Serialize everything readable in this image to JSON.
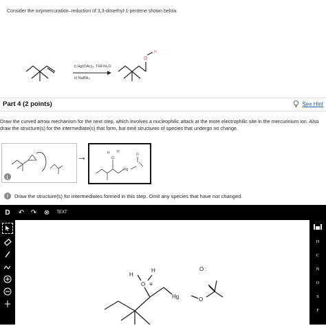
{
  "question": {
    "intro": "Consider the oxymercuration–reduction of 3,3-dimethyl-1-pentene shown below.",
    "reagent_step1": "i) Hg(OAc)₂, THF/H₂O",
    "reagent_step2": "ii) NaBH₄",
    "product_oxygen": "O",
    "product_hydrogen": "H"
  },
  "part": {
    "title": "Part 4",
    "points": "(2 points)",
    "hint_label": "See Hint"
  },
  "instructions": "Draw the curved arrow mechanism for the next step, which involves a nucleophilic attack at the more electrophilic site in the mercurinium ion. Also draw the structure(s) for the intermediate(s) that form, but omit structures of species that undergo no change.",
  "mechanism_panels": {
    "info_icon": "i",
    "arrow": "→",
    "panel2_atoms": [
      "H",
      "H",
      "O",
      "Hg",
      "O"
    ]
  },
  "step_instruction": "Draw the structure(s) for intermediates formed in this step. Omit any species that have not changed.",
  "toolbar": {
    "top_tools": [
      "D",
      "↶",
      "↷",
      "⊗",
      "TEXT"
    ],
    "left_tools": [
      "select",
      "erase",
      "bond",
      "chain",
      "plus",
      "minus",
      "arrow"
    ],
    "elements": [
      "H",
      "C",
      "N",
      "O",
      "S",
      "F"
    ]
  },
  "canvas_molecule": {
    "atoms": [
      "H",
      "H",
      "O",
      "Hg",
      "O",
      "O"
    ],
    "charge": "⊕",
    "lone_pairs": ":"
  },
  "colors": {
    "accent_blue": "#1f5fa8",
    "oxygen_red": "#d9534f",
    "toolbar_bg": "#000000"
  }
}
